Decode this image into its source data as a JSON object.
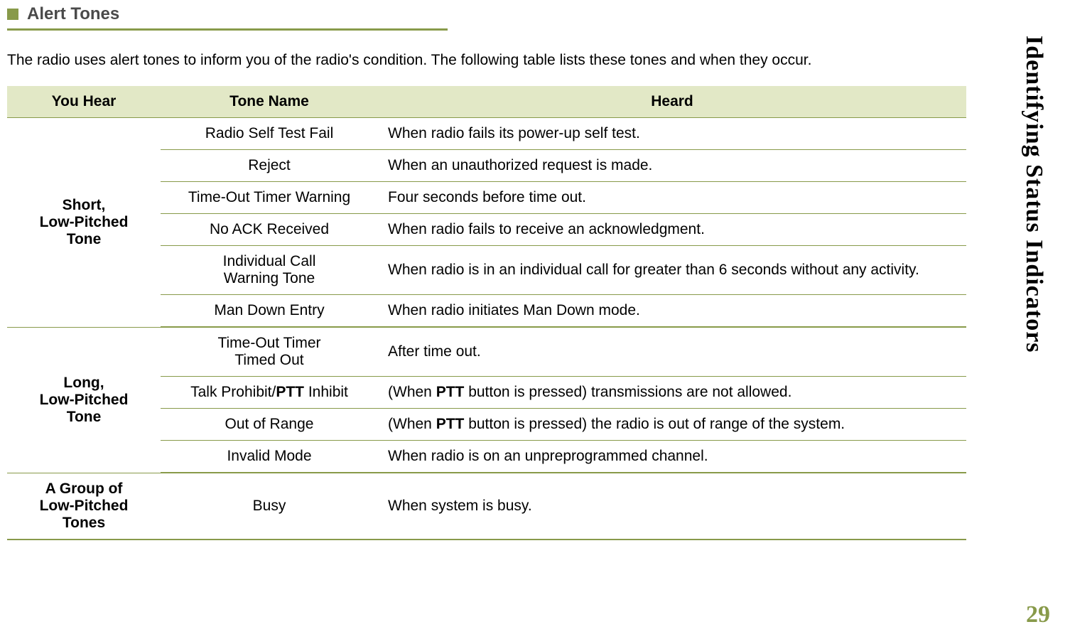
{
  "heading": "Alert Tones",
  "intro": "The radio uses alert tones to inform you of the radio's condition. The following table lists these tones and when they occur.",
  "side_tab": "Identifying Status Indicators",
  "page_number": "29",
  "table": {
    "headers": {
      "you_hear": "You Hear",
      "tone_name": "Tone Name",
      "heard": "Heard"
    },
    "groups": [
      {
        "you_hear": "Short,\nLow-Pitched\nTone",
        "rows": [
          {
            "tone_name": "Radio Self Test Fail",
            "heard": "When radio fails its power-up self test."
          },
          {
            "tone_name": "Reject",
            "heard": "When an unauthorized request is made."
          },
          {
            "tone_name": "Time-Out Timer Warning",
            "heard": "Four seconds before time out."
          },
          {
            "tone_name": "No ACK Received",
            "heard": "When radio fails to receive an acknowledgment."
          },
          {
            "tone_name": "Individual Call\nWarning Tone",
            "heard": "When radio is in an individual call for greater than 6 seconds without any activity."
          },
          {
            "tone_name": "Man Down Entry",
            "heard": "When radio initiates Man Down mode."
          }
        ]
      },
      {
        "you_hear": "Long,\nLow-Pitched\nTone",
        "rows": [
          {
            "tone_name": "Time-Out Timer\nTimed Out",
            "heard": "After time out."
          },
          {
            "tone_name_html": "Talk Prohibit/<b>PTT</b> Inhibit",
            "heard_html": "(When <b>PTT</b> button is pressed) transmissions are not allowed."
          },
          {
            "tone_name": "Out of Range",
            "heard_html": "(When <b>PTT</b> button is pressed) the radio is out of range of the system."
          },
          {
            "tone_name": "Invalid Mode",
            "heard": "When radio is on an unpreprogrammed channel."
          }
        ]
      },
      {
        "you_hear": "A Group of\nLow-Pitched\nTones",
        "rows": [
          {
            "tone_name": "Busy",
            "heard": "When system is busy."
          }
        ]
      }
    ]
  }
}
